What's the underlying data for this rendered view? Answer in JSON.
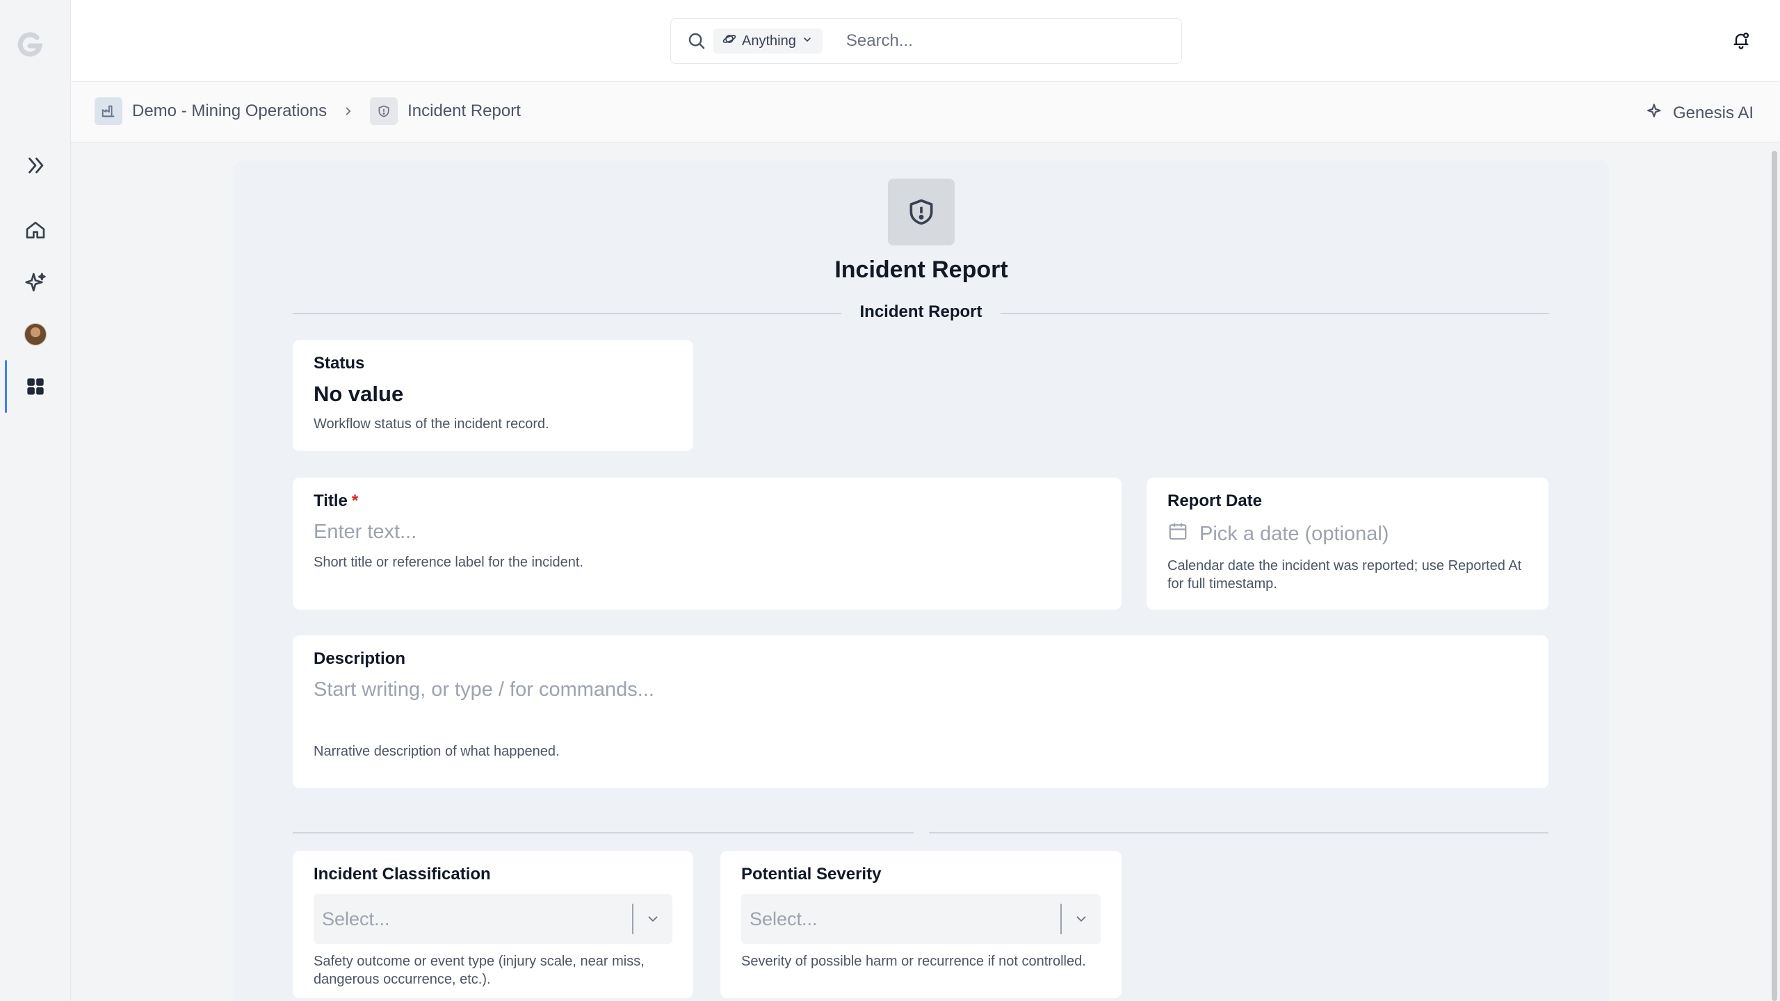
{
  "colors": {
    "accent": "#3b82f6",
    "required": "#dc2626",
    "rail_bg": "#f3f4f6",
    "panel_bg": "#eef1f5"
  },
  "rail": {
    "icons": [
      "logo-icon",
      "expand-icon",
      "home-icon",
      "sparkle-icon",
      "avatar",
      "apps-grid-icon"
    ]
  },
  "search": {
    "scope_label": "Anything",
    "placeholder": "Search..."
  },
  "breadcrumb": {
    "items": [
      {
        "label": "Demo - Mining Operations",
        "icon": "factory-icon"
      },
      {
        "label": "Incident Report",
        "icon": "shield-alert-icon"
      }
    ]
  },
  "genesis": {
    "label": "Genesis AI"
  },
  "form": {
    "title": "Incident Report",
    "section_title": "Incident Report",
    "status": {
      "label": "Status",
      "value": "No value",
      "help": "Workflow status of the incident record."
    },
    "title_field": {
      "label": "Title",
      "required_mark": "*",
      "placeholder": "Enter text...",
      "help": "Short title or reference label for the incident."
    },
    "report_date": {
      "label": "Report Date",
      "placeholder": "Pick a date (optional)",
      "help": "Calendar date the incident was reported; use Reported At for full timestamp."
    },
    "description": {
      "label": "Description",
      "placeholder": "Start writing, or type / for commands...",
      "help": "Narrative description of what happened."
    },
    "incident_classification": {
      "label": "Incident Classification",
      "placeholder": "Select...",
      "help": "Safety outcome or event type (injury scale, near miss, dangerous occurrence, etc.)."
    },
    "potential_severity": {
      "label": "Potential Severity",
      "placeholder": "Select...",
      "help": "Severity of possible harm or recurrence if not controlled."
    }
  }
}
